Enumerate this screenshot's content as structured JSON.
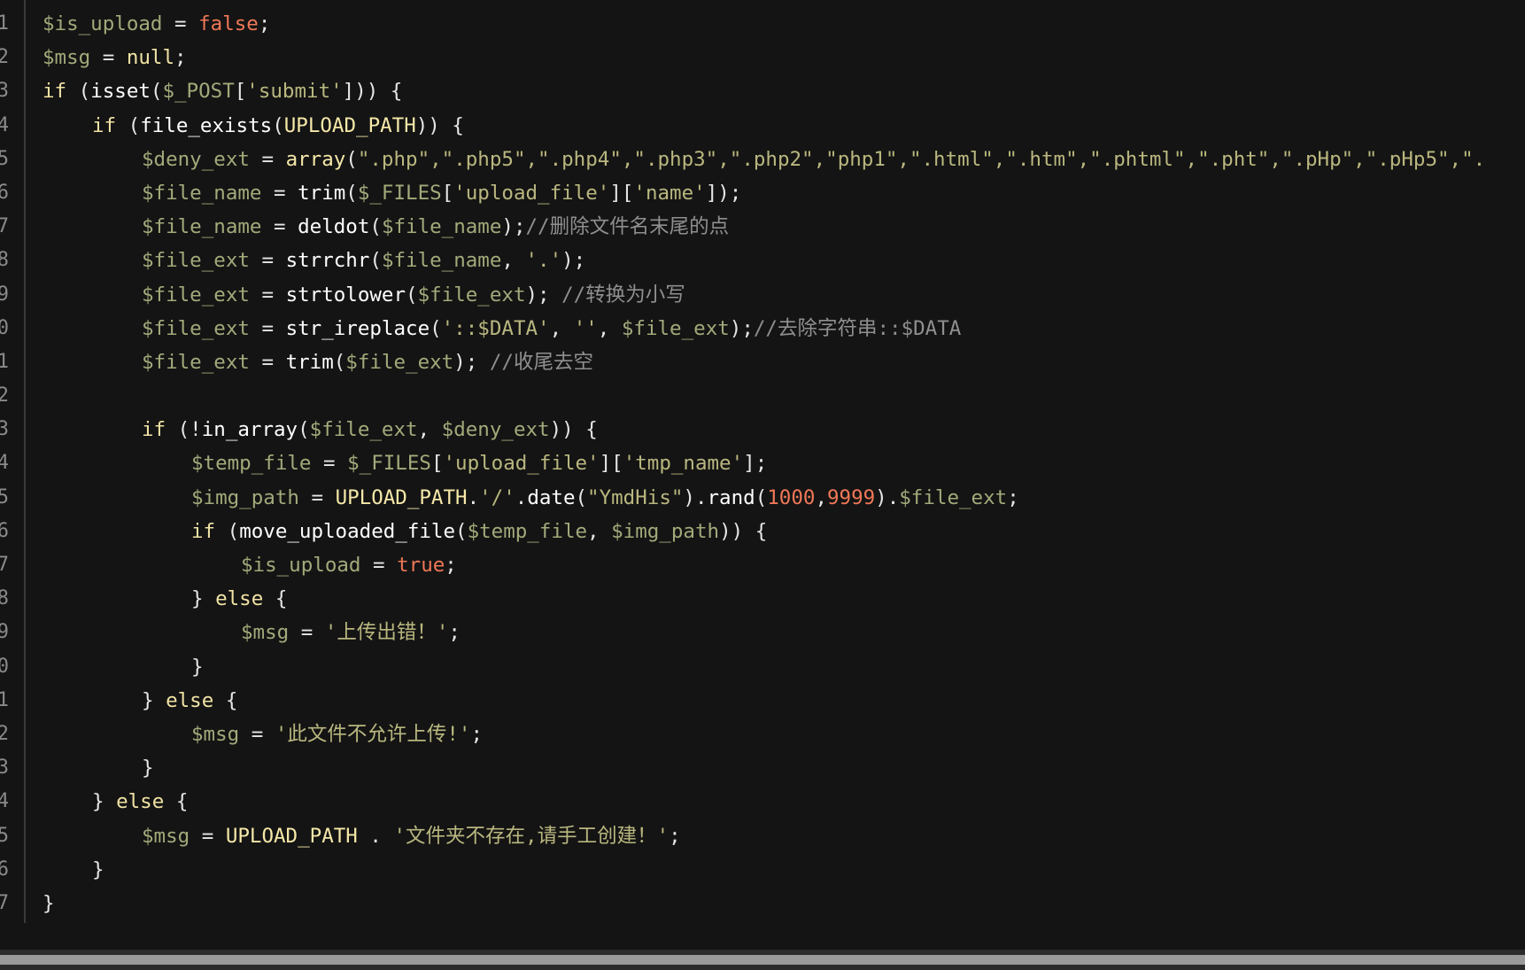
{
  "colors": {
    "background": "#141414",
    "variable": "#a3a97a",
    "keyword": "#f1e3a4",
    "function": "#ffffff",
    "number": "#ef7857",
    "string": "#b9b77f",
    "comment": "#8f8f8f"
  },
  "line_numbers": [
    "1",
    "2",
    "3",
    "4",
    "5",
    "6",
    "7",
    "8",
    "9",
    "0",
    "1",
    "2",
    "3",
    "4",
    "5",
    "6",
    "7",
    "8",
    "9",
    "0",
    "1",
    "2",
    "3",
    "4",
    "5",
    "6",
    "7"
  ],
  "code": {
    "l1": {
      "t0": "$is_upload",
      "t1": " = ",
      "t2": "false",
      "t3": ";"
    },
    "l2": {
      "t0": "$msg",
      "t1": " = ",
      "t2": "null",
      "t3": ";"
    },
    "l3": {
      "t0": "if",
      "t1": " (",
      "t2": "isset",
      "t3": "(",
      "t4": "$_POST",
      "t5": "[",
      "t6": "'submit'",
      "t7": "])) {"
    },
    "l4": {
      "t0": "if",
      "t1": " (",
      "t2": "file_exists",
      "t3": "(",
      "t4": "UPLOAD_PATH",
      "t5": ")) {"
    },
    "l5": {
      "t0": "$deny_ext",
      "t1": " = ",
      "t2": "array",
      "t3": "(",
      "t4": "\".php\",\".php5\",\".php4\",\".php3\",\".php2\",\"php1\",\".html\",\".htm\",\".phtml\",\".pht\",\".pHp\",\".pHp5\",\"."
    },
    "l6": {
      "t0": "$file_name",
      "t1": " = ",
      "t2": "trim",
      "t3": "(",
      "t4": "$_FILES",
      "t5": "[",
      "t6": "'upload_file'",
      "t7": "][",
      "t8": "'name'",
      "t9": "]);"
    },
    "l7": {
      "t0": "$file_name",
      "t1": " = ",
      "t2": "deldot",
      "t3": "(",
      "t4": "$file_name",
      "t5": ");",
      "t6": "//删除文件名末尾的点"
    },
    "l8": {
      "t0": "$file_ext",
      "t1": " = ",
      "t2": "strrchr",
      "t3": "(",
      "t4": "$file_name",
      "t5": ", ",
      "t6": "'.'",
      "t7": ");"
    },
    "l9": {
      "t0": "$file_ext",
      "t1": " = ",
      "t2": "strtolower",
      "t3": "(",
      "t4": "$file_ext",
      "t5": "); ",
      "t6": "//转换为小写"
    },
    "l10": {
      "t0": "$file_ext",
      "t1": " = ",
      "t2": "str_ireplace",
      "t3": "(",
      "t4": "'::$DATA'",
      "t5": ", ",
      "t6": "''",
      "t7": ", ",
      "t8": "$file_ext",
      "t9": ");",
      "t10": "//去除字符串::$DATA"
    },
    "l11": {
      "t0": "$file_ext",
      "t1": " = ",
      "t2": "trim",
      "t3": "(",
      "t4": "$file_ext",
      "t5": "); ",
      "t6": "//收尾去空"
    },
    "l13": {
      "t0": "if",
      "t1": " (!",
      "t2": "in_array",
      "t3": "(",
      "t4": "$file_ext",
      "t5": ", ",
      "t6": "$deny_ext",
      "t7": ")) {"
    },
    "l14": {
      "t0": "$temp_file",
      "t1": " = ",
      "t2": "$_FILES",
      "t3": "[",
      "t4": "'upload_file'",
      "t5": "][",
      "t6": "'tmp_name'",
      "t7": "];"
    },
    "l15": {
      "t0": "$img_path",
      "t1": " = ",
      "t2": "UPLOAD_PATH",
      "t3": ".",
      "t4": "'/'",
      "t5": ".",
      "t6": "date",
      "t7": "(",
      "t8": "\"YmdHis\"",
      "t9": ").",
      "t10": "rand",
      "t11": "(",
      "t12": "1000",
      "t13": ",",
      "t14": "9999",
      "t15": ").",
      "t16": "$file_ext",
      "t17": ";"
    },
    "l16": {
      "t0": "if",
      "t1": " (",
      "t2": "move_uploaded_file",
      "t3": "(",
      "t4": "$temp_file",
      "t5": ", ",
      "t6": "$img_path",
      "t7": ")) {"
    },
    "l17": {
      "t0": "$is_upload",
      "t1": " = ",
      "t2": "true",
      "t3": ";"
    },
    "l18": {
      "t0": "} ",
      "t1": "else",
      "t2": " {"
    },
    "l19": {
      "t0": "$msg",
      "t1": " = ",
      "t2": "'上传出错！'",
      "t3": ";"
    },
    "l20": {
      "t0": "}"
    },
    "l21": {
      "t0": "} ",
      "t1": "else",
      "t2": " {"
    },
    "l22": {
      "t0": "$msg",
      "t1": " = ",
      "t2": "'此文件不允许上传!'",
      "t3": ";"
    },
    "l23": {
      "t0": "}"
    },
    "l24": {
      "t0": "} ",
      "t1": "else",
      "t2": " {"
    },
    "l25": {
      "t0": "$msg",
      "t1": " = ",
      "t2": "UPLOAD_PATH",
      "t3": " . ",
      "t4": "'文件夹不存在,请手工创建！'",
      "t5": ";"
    },
    "l26": {
      "t0": "}"
    },
    "l27": {
      "t0": "}"
    }
  }
}
